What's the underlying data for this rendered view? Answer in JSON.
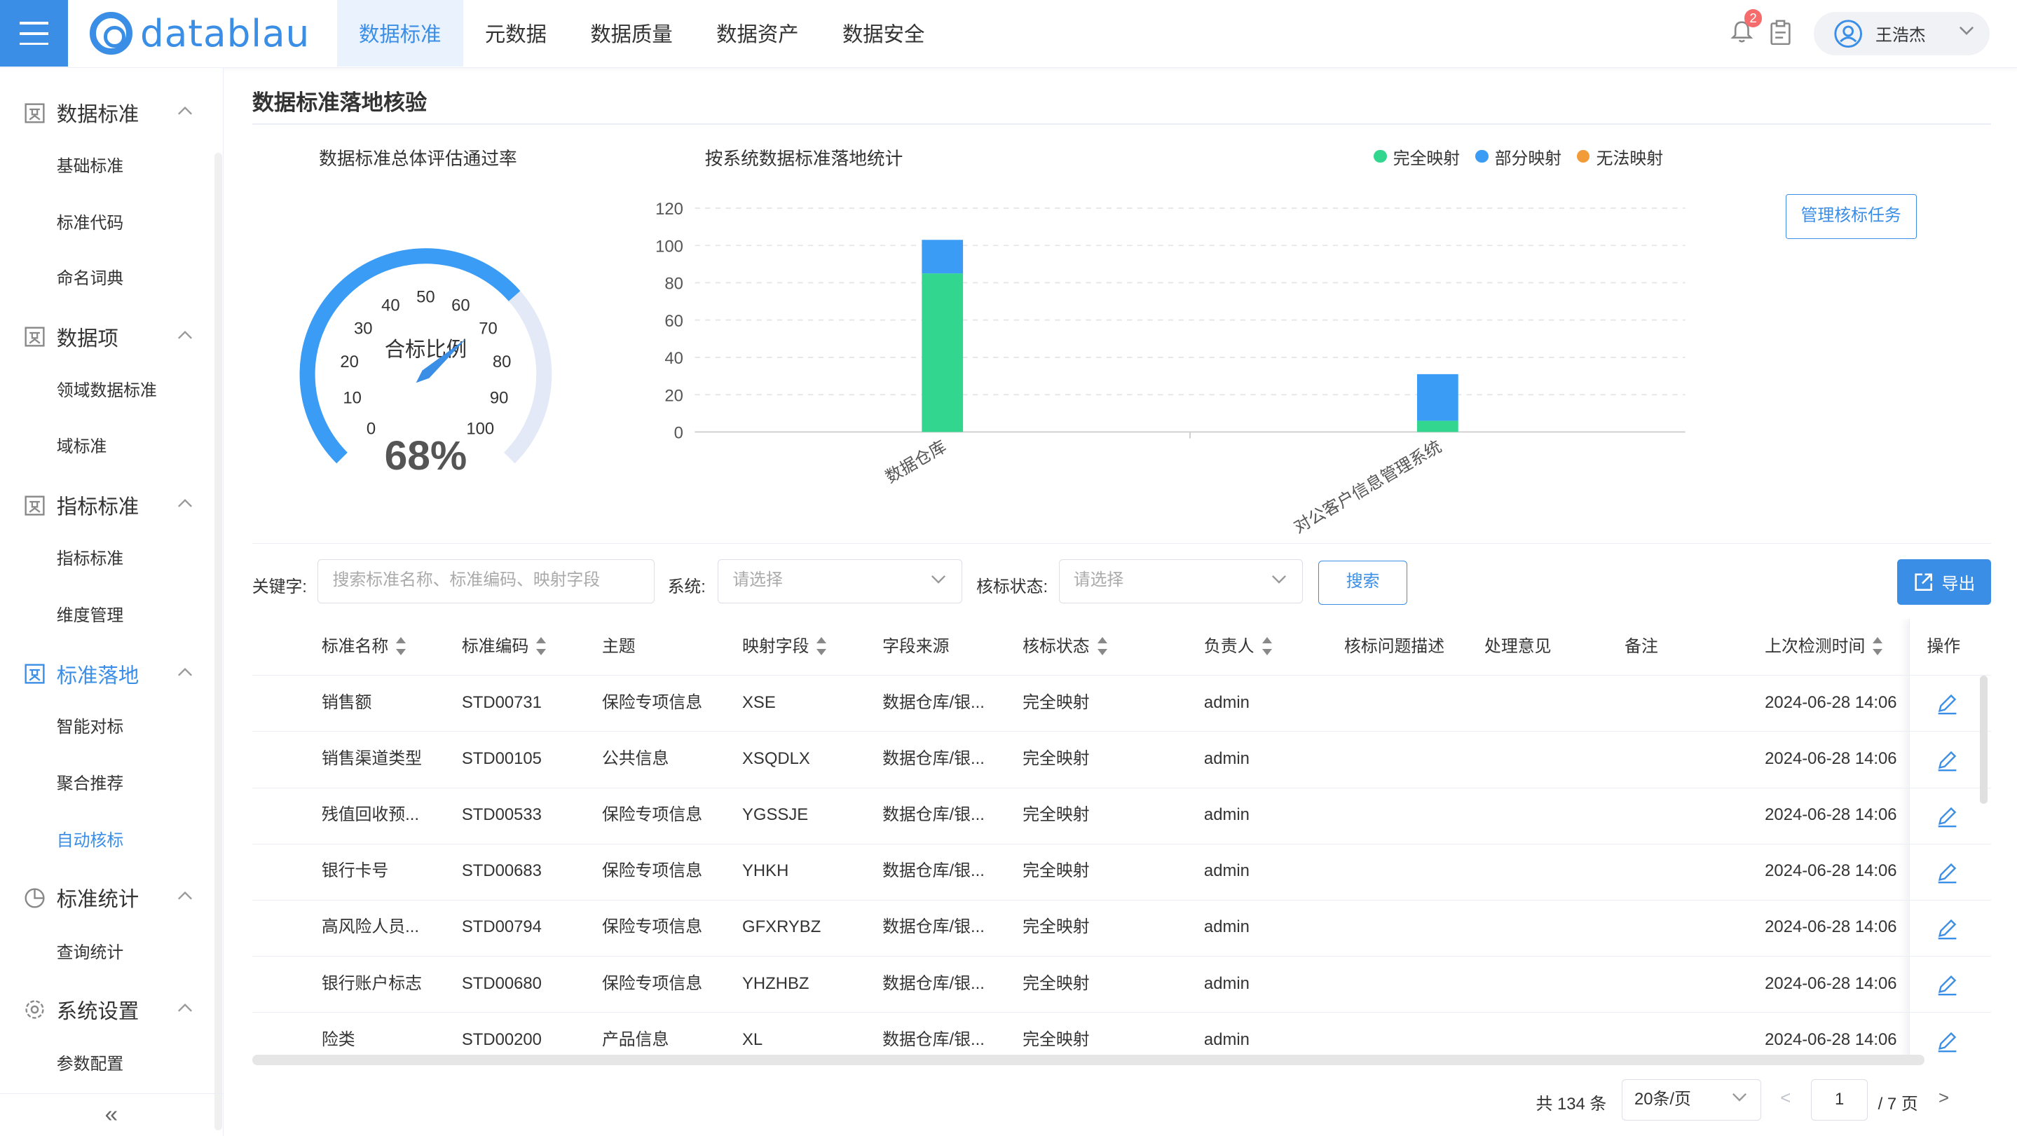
{
  "header": {
    "logo": "datablau",
    "nav": [
      "数据标准",
      "元数据",
      "数据质量",
      "数据资产",
      "数据安全"
    ],
    "notification_count": "2",
    "user": "王浩杰"
  },
  "sidebar": {
    "groups": [
      {
        "label": "数据标准",
        "items": [
          "基础标准",
          "标准代码",
          "命名词典"
        ]
      },
      {
        "label": "数据项",
        "items": [
          "领域数据标准",
          "域标准"
        ]
      },
      {
        "label": "指标标准",
        "items": [
          "指标标准",
          "维度管理"
        ]
      },
      {
        "label": "标准落地",
        "items": [
          "智能对标",
          "聚合推荐",
          "自动核标"
        ]
      },
      {
        "label": "标准统计",
        "items": [
          "查询统计"
        ]
      },
      {
        "label": "系统设置",
        "items": [
          "参数配置"
        ]
      }
    ],
    "active_item": "自动核标",
    "collapse_icon": "«"
  },
  "page": {
    "title": "数据标准落地核验",
    "manage_button": "管理核标任务"
  },
  "gauge": {
    "title": "数据标准总体评估通过率",
    "label": "合标比例",
    "value_text": "68%",
    "value": 68,
    "ticks": [
      "0",
      "10",
      "20",
      "30",
      "40",
      "50",
      "60",
      "70",
      "80",
      "90",
      "100"
    ]
  },
  "chart_data": {
    "type": "bar",
    "title": "按系统数据标准落地统计",
    "stacked": true,
    "categories": [
      "数据仓库",
      "对公客户信息管理系统"
    ],
    "series": [
      {
        "name": "完全映射",
        "color": "#33d68f",
        "values": [
          85,
          6
        ]
      },
      {
        "name": "部分映射",
        "color": "#3a9cf5",
        "values": [
          18,
          25
        ]
      },
      {
        "name": "无法映射",
        "color": "#f29b39",
        "values": [
          0,
          0
        ]
      }
    ],
    "ylim": [
      0,
      120
    ],
    "yticks": [
      "0",
      "20",
      "40",
      "60",
      "80",
      "100",
      "120"
    ],
    "grid": true,
    "legend_position": "top-right"
  },
  "filters": {
    "keyword_label": "关键字:",
    "keyword_placeholder": "搜索标准名称、标准编码、映射字段",
    "system_label": "系统:",
    "system_placeholder": "请选择",
    "status_label": "核标状态:",
    "status_placeholder": "请选择",
    "search_button": "搜索",
    "export_button": "导出"
  },
  "table": {
    "columns": [
      "标准名称",
      "标准编码",
      "主题",
      "映射字段",
      "字段来源",
      "核标状态",
      "负责人",
      "核标问题描述",
      "处理意见",
      "备注",
      "上次检测时间",
      "操作"
    ],
    "rows": [
      [
        "销售额",
        "STD00731",
        "保险专项信息",
        "XSE",
        "数据仓库/银...",
        "完全映射",
        "admin",
        "",
        "",
        "",
        "2024-06-28 14:06"
      ],
      [
        "销售渠道类型",
        "STD00105",
        "公共信息",
        "XSQDLX",
        "数据仓库/银...",
        "完全映射",
        "admin",
        "",
        "",
        "",
        "2024-06-28 14:06"
      ],
      [
        "残值回收预...",
        "STD00533",
        "保险专项信息",
        "YGSSJE",
        "数据仓库/银...",
        "完全映射",
        "admin",
        "",
        "",
        "",
        "2024-06-28 14:06"
      ],
      [
        "银行卡号",
        "STD00683",
        "保险专项信息",
        "YHKH",
        "数据仓库/银...",
        "完全映射",
        "admin",
        "",
        "",
        "",
        "2024-06-28 14:06"
      ],
      [
        "高风险人员...",
        "STD00794",
        "保险专项信息",
        "GFXRYBZ",
        "数据仓库/银...",
        "完全映射",
        "admin",
        "",
        "",
        "",
        "2024-06-28 14:06"
      ],
      [
        "银行账户标志",
        "STD00680",
        "保险专项信息",
        "YHZHBZ",
        "数据仓库/银...",
        "完全映射",
        "admin",
        "",
        "",
        "",
        "2024-06-28 14:06"
      ],
      [
        "险类",
        "STD00200",
        "产品信息",
        "XL",
        "数据仓库/银...",
        "完全映射",
        "admin",
        "",
        "",
        "",
        "2024-06-28 14:06"
      ]
    ]
  },
  "pager": {
    "total": "共 134 条",
    "page_size": "20条/页",
    "current": "1",
    "of_pages": "/ 7 页"
  }
}
